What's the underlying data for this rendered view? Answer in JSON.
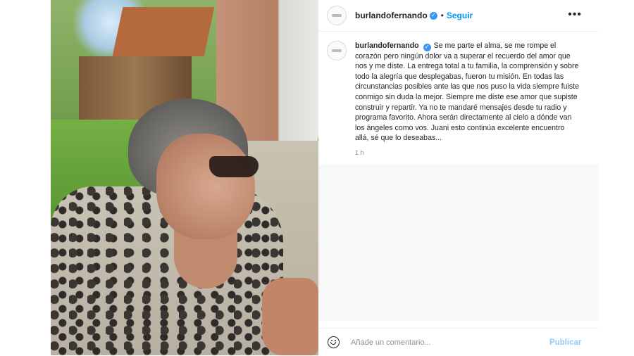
{
  "post": {
    "username": "burlandofernando",
    "follow_label": "Seguir",
    "separator": "•",
    "more_label": "•••",
    "caption": {
      "username": "burlandofernando",
      "text": "Se me parte el alma, se me rompe el corazón pero ningún dolor va a superar el recuerdo del amor que nos y me diste. La entrega total a tu familia, la comprensión y sobre todo la alegría que desplegabas, fueron tu misión. En todas las circunstancias posibles ante las que nos puso la vida siempre fuiste conmigo sin duda la mejor. Siempre me diste ese amor que supiste construir y repartir. Ya no te mandaré mensajes desde tu radio y programa favorito. Ahora serán directamente al cielo a dónde van los ángeles como vos. Juani esto continúa excelente encuentro allá, sé que lo deseabas...",
      "time": "1 h"
    },
    "comment": {
      "placeholder": "Añade un comentario...",
      "publish_label": "Publicar"
    }
  },
  "icons": {
    "verified": "verified-badge-icon",
    "more": "more-options-icon",
    "emoji": "emoji-icon"
  },
  "colors": {
    "accent": "#0095f6",
    "verified": "#3897f0",
    "publish_disabled": "#94c9f5"
  }
}
